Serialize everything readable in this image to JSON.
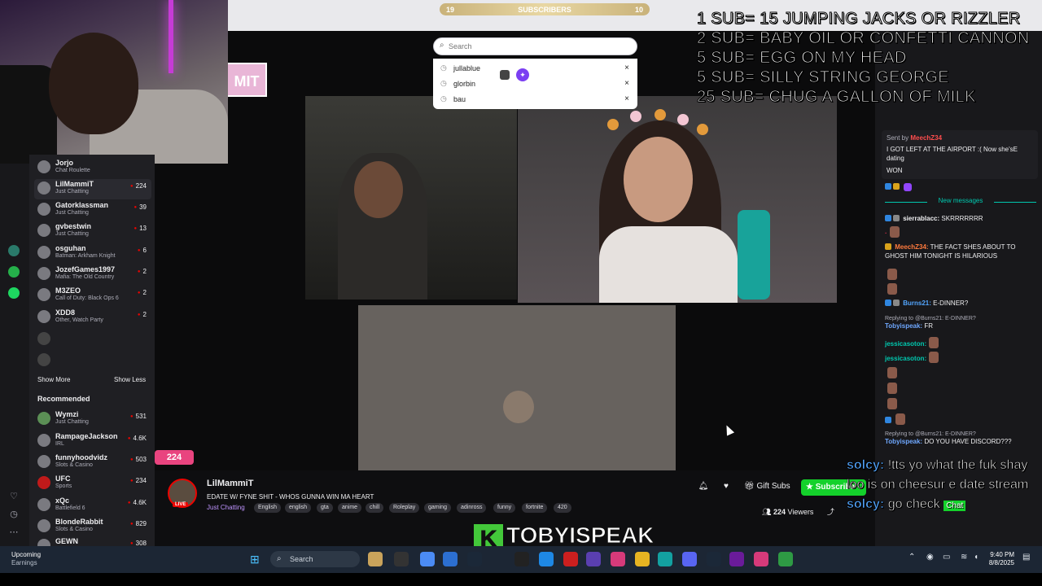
{
  "subscribers_bar": {
    "left": "19",
    "label": "SUBSCRIBERS",
    "right": "10"
  },
  "sub_goals": [
    "1 SUB= 15 JUMPING JACKS OR RIZZLER",
    "2 SUB= BABY OIL OR CONFETTI CANNON",
    "5 SUB= EGG ON MY HEAD",
    "5 SUB= SILLY STRING GEORGE",
    "25 SUB= CHUG A GALLON OF MILK"
  ],
  "search": {
    "placeholder": "Search",
    "history": [
      {
        "label": "jullablue"
      },
      {
        "label": "glorbin"
      },
      {
        "label": "bau"
      }
    ]
  },
  "sidebar": {
    "followed": [
      {
        "name": "LilMammiT",
        "game": "Just Chatting",
        "count": "224"
      },
      {
        "name": "Gatorklassman",
        "game": "Just Chatting",
        "count": "39"
      },
      {
        "name": "gvbestwin",
        "game": "Just Chatting",
        "count": "13"
      },
      {
        "name": "osguhan",
        "game": "Batman: Arkham Knight",
        "count": "6"
      },
      {
        "name": "JozefGames1997",
        "game": "Mafia: The Old Country",
        "count": "2"
      },
      {
        "name": "M3ZEO",
        "game": "Call of Duty: Black Ops 6",
        "count": "2"
      },
      {
        "name": "XDD8",
        "game": "Other, Watch Party",
        "count": "2"
      }
    ],
    "partial_top": {
      "name": "Jorjo",
      "game": "Chat Roulette"
    },
    "show_more": "Show More",
    "show_less": "Show Less",
    "recommended_heading": "Recommended",
    "recommended": [
      {
        "name": "Wymzi",
        "game": "Just Chatting",
        "count": "531"
      },
      {
        "name": "RampageJackson",
        "game": "IRL",
        "count": "4.6K"
      },
      {
        "name": "funnyhoodvidz",
        "game": "Slots & Casino",
        "count": "503"
      },
      {
        "name": "UFC",
        "game": "Sports",
        "count": "234"
      },
      {
        "name": "xQc",
        "game": "Battlefield 6",
        "count": "4.6K"
      },
      {
        "name": "BlondeRabbit",
        "game": "Slots & Casino",
        "count": "829"
      },
      {
        "name": "GEWN",
        "game": "",
        "count": "308"
      }
    ]
  },
  "player": {
    "logo_text": "MIT",
    "viewer_pill": "224"
  },
  "chat": {
    "pinned_by": "Sent by",
    "pinned_user": "MeechZ34",
    "pinned_text": "I GOT LEFT AT THE AIRPORT :( Now she'sE dating",
    "won": "WON",
    "new_messages": "New messages",
    "messages": [
      {
        "user": "sierrablacc:",
        "text": "SKRRRRRRR"
      },
      {
        "user": "MeechZ34:",
        "text": "THE FACT SHES ABOUT TO GHOST HIM TONIGHT IS HILARIOUS"
      },
      {
        "user": "Burns21:",
        "text": "E-DINNER?"
      },
      {
        "user": "Tobyispeak:",
        "text": "FR"
      },
      {
        "user": "jessicasoton:",
        "text": ""
      },
      {
        "user": "jessicasoton:",
        "text": ""
      },
      {
        "user": "Tobyispeak:",
        "text": "DO YOU HAVE DISCORD???"
      }
    ],
    "reply_to": "Replying to @Burns21: E-DINNER?"
  },
  "overlay_chat": [
    {
      "user": "solcy:",
      "text": "!tts yo what the fuk shay loo is on cheesur e date stream"
    },
    {
      "user": "solcy:",
      "text": "go check"
    }
  ],
  "overlay_chat_button": "Chat",
  "stream_info": {
    "channel": "LilMammiT",
    "title": "EDATE W/ FYNE SHIT - WHOS GUNNA WIN MA HEART",
    "category": "Just Chatting",
    "live": "LIVE",
    "tags": [
      "English",
      "english",
      "gta",
      "anime",
      "chill",
      "Roleplay",
      "gaming",
      "adinross",
      "funny",
      "fortnite",
      "420"
    ],
    "gift_subs": "Gift Subs",
    "subscribe": "Subscribe",
    "viewers_count": "224",
    "viewers_label": "Viewers"
  },
  "watermark": "TOBYISPEAK",
  "taskbar": {
    "weather_title": "Upcoming",
    "weather_sub": "Earnings",
    "search_label": "Search",
    "time": "9:40 PM",
    "date": "8/8/2025"
  }
}
